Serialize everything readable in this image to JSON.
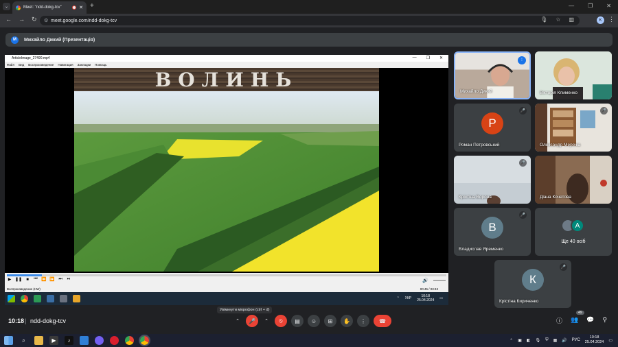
{
  "browser": {
    "tab_title": "Meet: \"ndd-dokg-tcv\"",
    "tab_close": "✕",
    "new_tab": "+",
    "url": "meet.google.com/ndd-dokg-tcv",
    "profile_initial": "K",
    "window_controls": [
      "—",
      "❐",
      "✕"
    ]
  },
  "presenter": {
    "avatar_initial": "М",
    "label": "Михайло Дикий (Презентація)"
  },
  "vlc": {
    "title": "ArticleImage_27490.mp4",
    "menu": [
      "Файл",
      "Вид",
      "Воспроизведение",
      "Навигация",
      "Закладки",
      "Помощь"
    ],
    "video_title": "ВОЛИНЬ",
    "status": "Воспроизведение (HW)",
    "time": "00:45 / 03:43",
    "progress": 0.08
  },
  "inner_tray": {
    "lang": "УКР",
    "time": "10:18",
    "date": "25.04.2024"
  },
  "tiles": [
    {
      "name": "Михайло Дикий",
      "kind": "photo"
    },
    {
      "name": "Вікторія Клименко",
      "kind": "photo"
    },
    {
      "name": "Роман Петровський",
      "kind": "avatar",
      "initial": "Р",
      "color": "#d84315"
    },
    {
      "name": "Олександр Мережа",
      "kind": "photo"
    },
    {
      "name": "Крістіна Ворона",
      "kind": "photo"
    },
    {
      "name": "Діана Кочетова",
      "kind": "photo"
    },
    {
      "name": "Владислав Яременко",
      "kind": "avatar",
      "initial": "В",
      "color": "#607d8b"
    },
    {
      "name": "Ще 40 осіб",
      "kind": "more",
      "initial": "А"
    },
    {
      "name": "Крістіна Кириченко",
      "kind": "avatar",
      "initial": "К",
      "color": "#607d8b"
    }
  ],
  "meet": {
    "time": "10:18",
    "separator": "|",
    "code": "ndd-dokg-tcv",
    "tooltip": "Увімкнути мікрофон (ctrl + d)",
    "participants_badge": "49"
  },
  "taskbar": {
    "lang": "РУС",
    "time": "10:18",
    "date": "25.04.2024"
  }
}
